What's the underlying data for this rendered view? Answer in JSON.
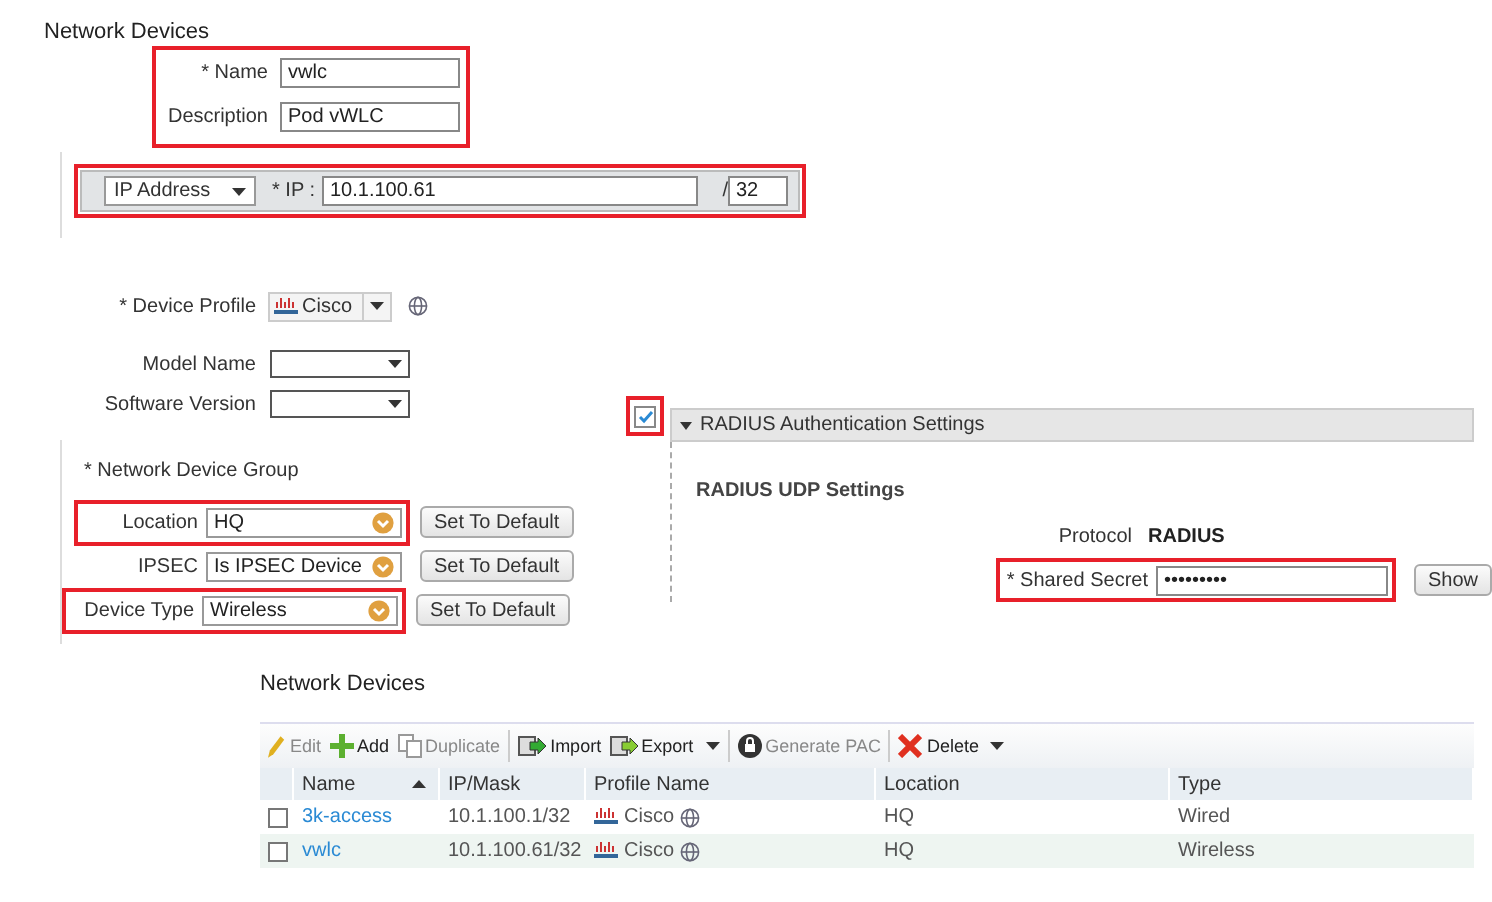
{
  "title": "Network Devices",
  "general": {
    "highlighted": true,
    "fields": [
      {
        "label": "* Name",
        "value": "vwlc"
      },
      {
        "label": "Description",
        "value": "Pod vWLC"
      }
    ]
  },
  "ip_bar": {
    "highlighted": true,
    "address_type": "IP Address",
    "ip_label": "* IP :",
    "ip": "10.1.100.61",
    "separator": "/",
    "mask": "32"
  },
  "device_profile": {
    "label": "* Device Profile",
    "value": "Cisco"
  },
  "selects": [
    {
      "label": "Model Name"
    },
    {
      "label": "Software Version"
    }
  ],
  "radius_toggle": {
    "checked": true,
    "highlighted": true
  },
  "device_group": {
    "title": "* Network Device Group",
    "rows": [
      {
        "label": "Location",
        "value": "HQ",
        "button": "Set To Default",
        "highlighted": true
      },
      {
        "label": "IPSEC",
        "value": "Is IPSEC Device",
        "button": "Set To Default",
        "highlighted": false
      },
      {
        "label": "Device Type",
        "value": "Wireless",
        "button": "Set To Default",
        "highlighted": true
      }
    ]
  },
  "radius": {
    "header": "RADIUS Authentication Settings",
    "expanded": true,
    "subtitle": "RADIUS UDP Settings",
    "protocol_label": "Protocol",
    "protocol": "RADIUS",
    "secret_label": "* Shared Secret",
    "secret": "•••••••••",
    "highlighted": true,
    "show_button": "Show"
  },
  "list": {
    "title": "Network Devices",
    "toolbar": [
      {
        "label": "Edit",
        "kind": "edit",
        "disabled": true,
        "menu": false
      },
      {
        "label": "Add",
        "kind": "add",
        "disabled": false,
        "menu": false
      },
      {
        "label": "Duplicate",
        "kind": "duplicate",
        "disabled": true,
        "menu": false
      },
      {
        "label": "Import",
        "kind": "import",
        "disabled": false,
        "menu": false
      },
      {
        "label": "Export",
        "kind": "export",
        "disabled": false,
        "menu": true
      },
      {
        "label": "Generate PAC",
        "kind": "pac",
        "disabled": true,
        "menu": false
      },
      {
        "label": "Delete",
        "kind": "delete",
        "disabled": false,
        "menu": true
      }
    ],
    "columns": [
      {
        "label": "Name",
        "sorted": true
      },
      {
        "label": "IP/Mask",
        "sorted": false
      },
      {
        "label": "Profile Name",
        "sorted": false
      },
      {
        "label": "Location",
        "sorted": false
      },
      {
        "label": "Type",
        "sorted": false
      }
    ],
    "rows": [
      {
        "checked": false,
        "name": "3k-access",
        "ip": "10.1.100.1/32",
        "profile": "Cisco",
        "location": "HQ",
        "type": "Wired"
      },
      {
        "checked": false,
        "name": "vwlc",
        "ip": "10.1.100.61/32",
        "profile": "Cisco",
        "location": "HQ",
        "type": "Wireless"
      }
    ]
  }
}
